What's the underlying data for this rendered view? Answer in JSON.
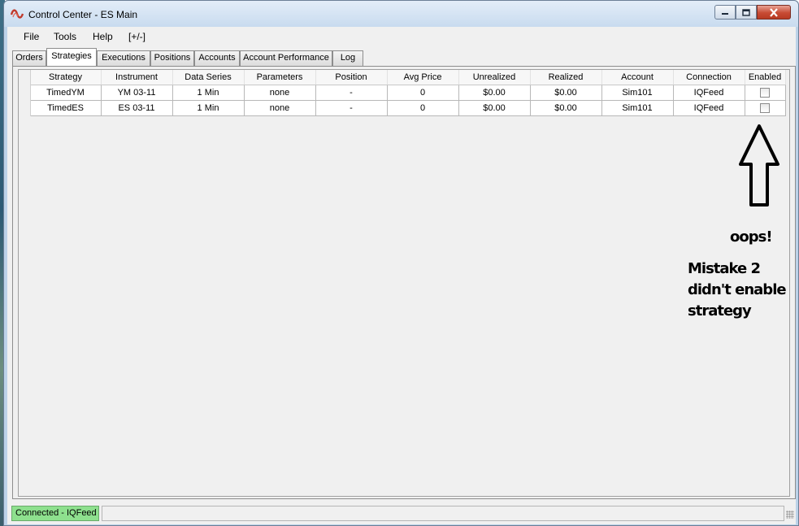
{
  "window": {
    "title": "Control Center - ES Main"
  },
  "menu": [
    "File",
    "Tools",
    "Help",
    "[+/-]"
  ],
  "tabs": [
    "Orders",
    "Strategies",
    "Executions",
    "Positions",
    "Accounts",
    "Account Performance",
    "Log"
  ],
  "active_tab": "Strategies",
  "grid": {
    "columns": [
      "Strategy",
      "Instrument",
      "Data Series",
      "Parameters",
      "Position",
      "Avg Price",
      "Unrealized",
      "Realized",
      "Account",
      "Connection",
      "Enabled"
    ],
    "rows": [
      [
        "TimedYM",
        "YM 03-11",
        "1 Min",
        "none",
        "-",
        "0",
        "$0.00",
        "$0.00",
        "Sim101",
        "IQFeed"
      ],
      [
        "TimedES",
        "ES 03-11",
        "1 Min",
        "none",
        "-",
        "0",
        "$0.00",
        "$0.00",
        "Sim101",
        "IQFeed"
      ]
    ],
    "enabled": [
      false,
      false
    ]
  },
  "annotations": {
    "oops": "oops!",
    "mistake_lines": [
      "Mistake 2",
      "didn't enable",
      "strategy"
    ]
  },
  "status": {
    "connection": "Connected - IQFeed",
    "connection_color": "#8ee08e"
  },
  "icons": {
    "app": "ninjatrader-logo-icon",
    "minimize": "minimize-icon",
    "maximize": "maximize-icon",
    "close": "close-icon",
    "arrow": "up-arrow-icon",
    "grip": "resize-grip-icon"
  }
}
